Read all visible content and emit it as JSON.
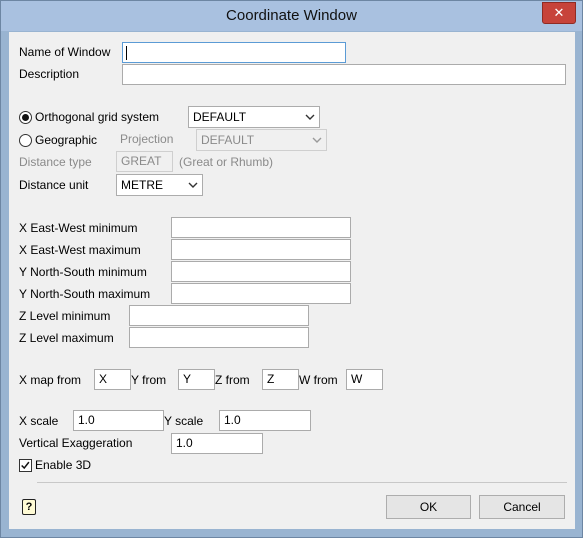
{
  "window": {
    "title": "Coordinate Window",
    "close_glyph": "✕"
  },
  "form": {
    "name_label": "Name of Window",
    "name_value": "",
    "description_label": "Description",
    "description_value": "",
    "orthogonal_label": "Orthogonal grid system",
    "orthogonal_value": "DEFAULT",
    "geographic_label": "Geographic",
    "projection_label": "Projection",
    "projection_value": "DEFAULT",
    "distance_type_label": "Distance type",
    "distance_type_value": "GREAT",
    "distance_type_hint": "(Great or Rhumb)",
    "distance_unit_label": "Distance unit",
    "distance_unit_value": "METRE",
    "x_min_label": "X East-West minimum",
    "x_min_value": "",
    "x_max_label": "X East-West maximum",
    "x_max_value": "",
    "y_min_label": "Y North-South minimum",
    "y_min_value": "",
    "y_max_label": "Y North-South maximum",
    "y_max_value": "",
    "z_min_label": "Z Level minimum",
    "z_min_value": "",
    "z_max_label": "Z Level maximum",
    "z_max_value": "",
    "x_map_label": "X map from",
    "x_map_value": "X",
    "y_map_label": "Y from",
    "y_map_value": "Y",
    "z_map_label": "Z from",
    "z_map_value": "Z",
    "w_map_label": "W from",
    "w_map_value": "W",
    "x_scale_label": "X scale",
    "x_scale_value": "1.0",
    "y_scale_label": "Y scale",
    "y_scale_value": "1.0",
    "vert_exag_label": "Vertical Exaggeration",
    "vert_exag_value": "1.0",
    "enable3d_label": "Enable 3D",
    "enable3d_checked": true
  },
  "footer": {
    "help_glyph": "?",
    "ok_label": "OK",
    "cancel_label": "Cancel"
  }
}
